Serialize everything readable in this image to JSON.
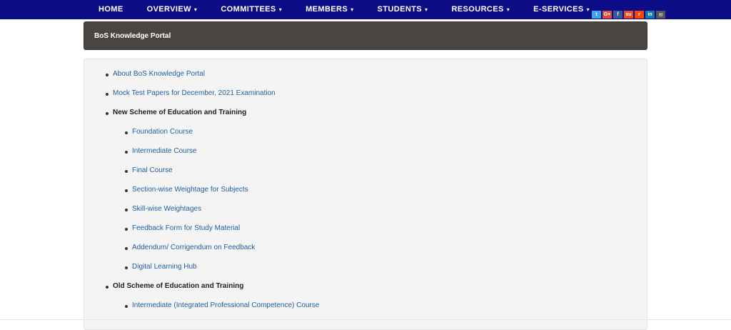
{
  "nav": {
    "items": [
      {
        "label": "HOME",
        "dropdown": false
      },
      {
        "label": "OVERVIEW",
        "dropdown": true
      },
      {
        "label": "COMMITTEES",
        "dropdown": true
      },
      {
        "label": "MEMBERS",
        "dropdown": true
      },
      {
        "label": "STUDENTS",
        "dropdown": true
      },
      {
        "label": "RESOURCES",
        "dropdown": true
      },
      {
        "label": "E-SERVICES",
        "dropdown": true
      }
    ],
    "caret": "▾",
    "background": "#0b0c86"
  },
  "social": [
    {
      "icon": "twitter-icon",
      "glyph": "t",
      "color": "#3fa4e8"
    },
    {
      "icon": "google-plus-icon",
      "glyph": "G+",
      "color": "#dd4b39"
    },
    {
      "icon": "facebook-icon",
      "glyph": "f",
      "color": "#3b5998"
    },
    {
      "icon": "stumbleupon-icon",
      "glyph": "su",
      "color": "#eb4924"
    },
    {
      "icon": "reddit-icon",
      "glyph": "r",
      "color": "#ff4500"
    },
    {
      "icon": "linkedin-icon",
      "glyph": "in",
      "color": "#0e76a8"
    },
    {
      "icon": "email-icon",
      "glyph": "✉",
      "color": "#555555"
    }
  ],
  "header": {
    "title": "BoS Knowledge Portal"
  },
  "content": {
    "about": "About BoS Knowledge Portal",
    "mock_tests": "Mock Test Papers for December, 2021 Examination",
    "new_scheme": "New Scheme of Education and Training",
    "new_scheme_items": [
      "Foundation Course",
      "Intermediate Course",
      "Final Course",
      "Section-wise Weightage for Subjects",
      "Skill-wise Weightages",
      "Feedback Form for Study Material",
      "Addendum/ Corrigendum on Feedback",
      "Digital Learning Hub"
    ],
    "old_scheme": "Old Scheme of Education and Training",
    "old_scheme_items": [
      "Intermediate (Integrated Professional Competence) Course"
    ]
  },
  "colors": {
    "link": "#1f5f9c",
    "header_panel": "#4a4543"
  }
}
